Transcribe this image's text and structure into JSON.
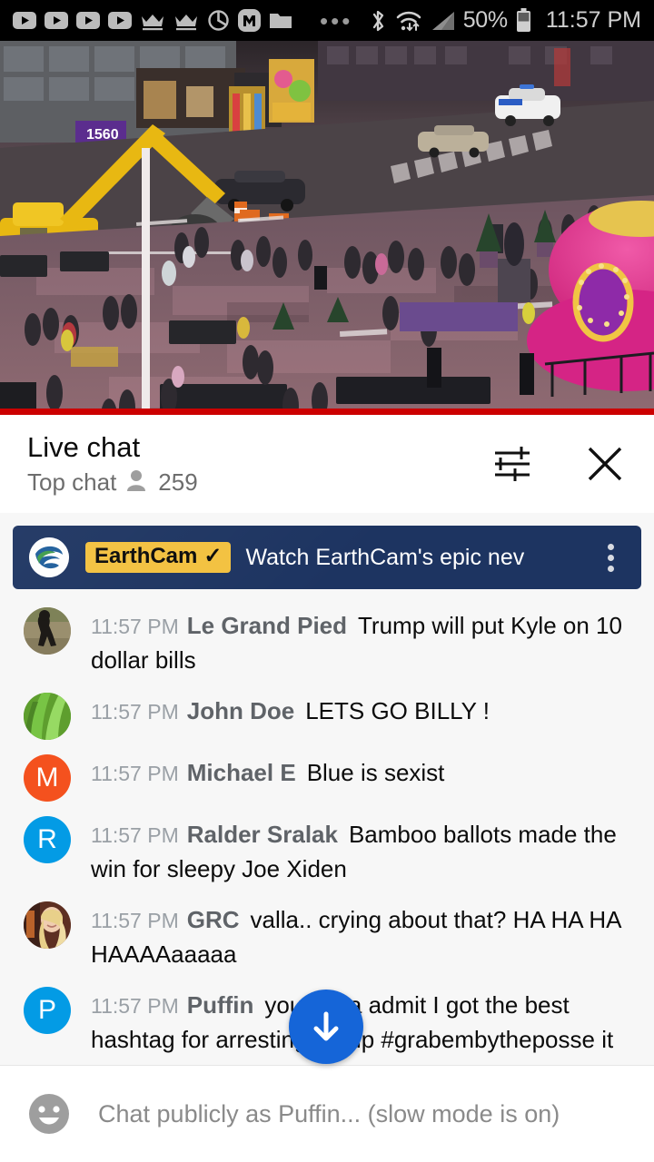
{
  "status_bar": {
    "icons_left": [
      "youtube-icon",
      "youtube-icon",
      "youtube-icon",
      "youtube-icon",
      "crown-icon",
      "crown-icon",
      "power-timer-icon",
      "m-app-icon",
      "folder-icon"
    ],
    "overflow": "•••",
    "icons_right": [
      "bluetooth-icon",
      "wifi-icon",
      "cell-signal-icon"
    ],
    "battery_percent": "50%",
    "clock": "11:57 PM"
  },
  "video": {
    "name": "times-square-live-stream",
    "progress_color": "#cc0000"
  },
  "chat_header": {
    "title": "Live chat",
    "mode": "Top chat",
    "viewer_count": "259",
    "filter_icon": "tune-icon",
    "close_icon": "close-icon"
  },
  "pinned": {
    "logo": "earthcam-logo",
    "badge_label": "EarthCam",
    "badge_verified": "✓",
    "message": "Watch EarthCam's epic nev",
    "badge_bg": "#f3c13f",
    "card_bg": "#1d3461",
    "menu_icon": "overflow-menu-icon"
  },
  "messages": [
    {
      "time": "11:57 PM",
      "author": "Le Grand Pied",
      "text": "Trump will put Kyle on 10 dollar bills",
      "avatar_type": "photo",
      "avatar_kind": "bigfoot",
      "avatar_letter": "",
      "avatar_color": "#8d8368"
    },
    {
      "time": "11:57 PM",
      "author": "John Doe",
      "text": "LETS GO BILLY !",
      "avatar_type": "photo",
      "avatar_kind": "plant",
      "avatar_letter": "",
      "avatar_color": "#5aa02c"
    },
    {
      "time": "11:57 PM",
      "author": "Michael E",
      "text": "Blue is sexist",
      "avatar_type": "letter",
      "avatar_kind": "letter",
      "avatar_letter": "M",
      "avatar_color": "#f4511e"
    },
    {
      "time": "11:57 PM",
      "author": "Ralder Sralak",
      "text": "Bamboo ballots made the win for sleepy Joe Xiden",
      "avatar_type": "letter",
      "avatar_kind": "letter",
      "avatar_letter": "R",
      "avatar_color": "#039be5"
    },
    {
      "time": "11:57 PM",
      "author": "GRC",
      "text": "valla.. crying about that? HA HA HA HAAAAaaaaa",
      "avatar_type": "photo",
      "avatar_kind": "person",
      "avatar_letter": "",
      "avatar_color": "#c7a28a"
    },
    {
      "time": "11:57 PM",
      "author": "Puffin",
      "text": "you gotta admit I got the best hashtag for arresting trump #grabembytheposse it works for Putin and Zuckerberg too",
      "avatar_type": "letter",
      "avatar_kind": "letter",
      "avatar_letter": "P",
      "avatar_color": "#039be5"
    }
  ],
  "scroll_fab": {
    "icon": "arrow-down-icon",
    "color": "#1565d8"
  },
  "chat_input": {
    "emoji_icon": "emoji-smiley-icon",
    "placeholder": "Chat publicly as Puffin... (slow mode is on)"
  }
}
